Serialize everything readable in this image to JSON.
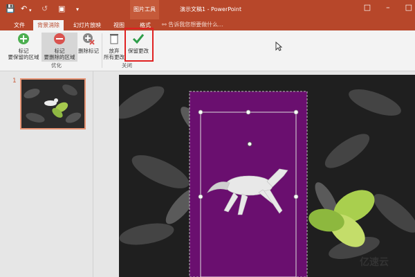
{
  "quick_access": {
    "undo_icon": "undo-icon",
    "redo_icon": "redo-icon"
  },
  "context_tab_label": "图片工具",
  "document_title": "演示文稿1 - PowerPoint",
  "tabs": [
    {
      "label": "文件"
    },
    {
      "label": "背景消除",
      "active": true
    },
    {
      "label": "幻灯片放映"
    },
    {
      "label": "视图"
    },
    {
      "label": "格式"
    }
  ],
  "tell_me": "告诉我您想要做什么...",
  "ribbon": {
    "buttons": [
      {
        "line1": "标记",
        "line2": "要保留的区域",
        "icon": "plus-circle-icon"
      },
      {
        "line1": "标记",
        "line2": "要删除的区域",
        "icon": "minus-circle-icon"
      },
      {
        "line1": "删除标记",
        "line2": "",
        "icon": "delete-mark-icon"
      },
      {
        "line1": "放弃",
        "line2": "所有更改",
        "icon": "discard-icon"
      },
      {
        "line1": "保留更改",
        "line2": "",
        "icon": "check-icon"
      }
    ],
    "groups": [
      {
        "label": "优化"
      },
      {
        "label": "关闭"
      }
    ]
  },
  "slide_panel": {
    "slide_number": "1"
  },
  "watermark": "亿速云",
  "colors": {
    "accent": "#b7472a",
    "purple": "#6a0f6f",
    "highlight": "#e02020"
  }
}
